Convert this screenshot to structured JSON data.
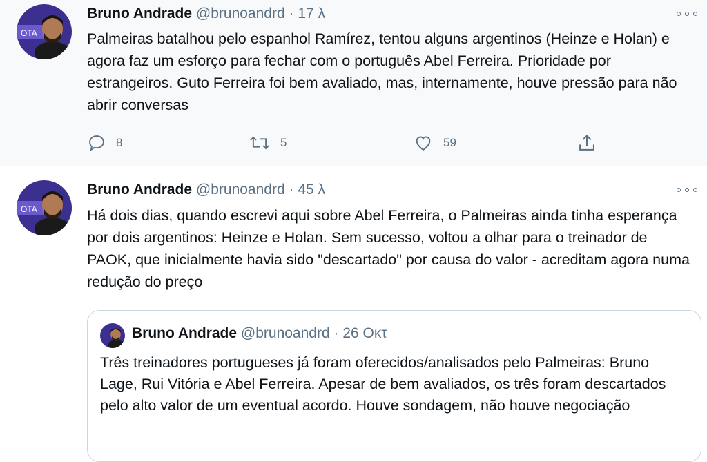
{
  "tweets": [
    {
      "name": "Bruno Andrade",
      "handle": "@brunoandrd",
      "separator": "·",
      "time": "17 λ",
      "text": "Palmeiras batalhou pelo espanhol Ramírez, tentou alguns argentinos (Heinze e Holan) e agora faz um esforço para fechar com o português Abel Ferreira. Prioridade por estrangeiros. Guto Ferreira foi bem avaliado, mas, internamente, houve pressão para não abrir conversas",
      "replies": "8",
      "retweets": "5",
      "likes": "59"
    },
    {
      "name": "Bruno Andrade",
      "handle": "@brunoandrd",
      "separator": "·",
      "time": "45 λ",
      "text": "Há dois dias, quando escrevi aqui sobre Abel Ferreira, o Palmeiras ainda tinha esperança por dois argentinos: Heinze e Holan. Sem sucesso, voltou a olhar para o treinador de PAOK, que inicialmente havia sido \"descartado\" por causa do valor - acreditam agora numa redução do preço",
      "quoted": {
        "name": "Bruno Andrade",
        "handle": "@brunoandrd",
        "separator": "·",
        "time": "26 Οκτ",
        "text": "Três treinadores portugueses já foram oferecidos/analisados pelo Palmeiras: Bruno Lage, Rui Vitória e Abel Ferreira. Apesar de bem avaliados, os três foram descartados pelo alto valor de um eventual acordo. Houve sondagem, não houve negociação"
      }
    }
  ],
  "icons": {
    "reply": "reply-icon",
    "retweet": "retweet-icon",
    "like": "heart-icon",
    "share": "share-icon",
    "more": "more-icon"
  },
  "colors": {
    "muted": "#5b7083",
    "border": "#ccd6dd",
    "hover_bg": "#f7f9fa"
  }
}
